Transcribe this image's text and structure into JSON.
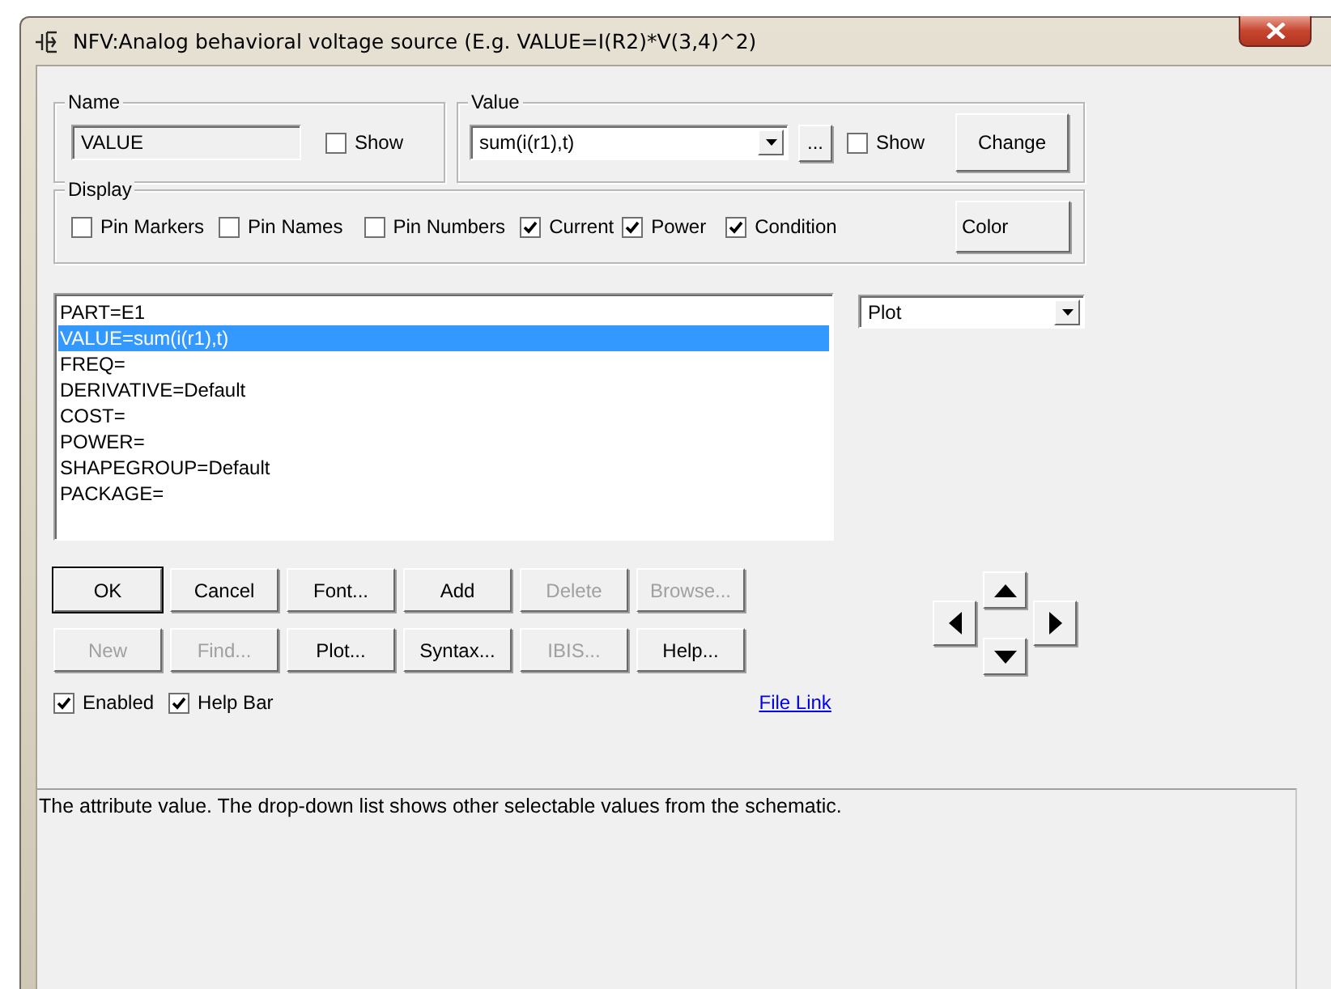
{
  "window": {
    "title": "NFV:Analog behavioral voltage source (E.g. VALUE=I(R2)*V(3,4)^2)"
  },
  "name_group": {
    "label": "Name",
    "value": "VALUE",
    "show": {
      "label": "Show",
      "checked": false
    }
  },
  "value_group": {
    "label": "Value",
    "value": "sum(i(r1),t)",
    "browse": "...",
    "show": {
      "label": "Show",
      "checked": false
    },
    "change": "Change"
  },
  "display": {
    "label": "Display",
    "options": [
      {
        "label": "Pin Markers",
        "checked": false
      },
      {
        "label": "Pin Names",
        "checked": false
      },
      {
        "label": "Pin Numbers",
        "checked": false
      },
      {
        "label": "Current",
        "checked": true
      },
      {
        "label": "Power",
        "checked": true
      },
      {
        "label": "Condition",
        "checked": true
      }
    ],
    "color_button": "Color"
  },
  "attributes": [
    {
      "text": "PART=E1",
      "selected": false
    },
    {
      "text": "VALUE=sum(i(r1),t)",
      "selected": true
    },
    {
      "text": "FREQ=",
      "selected": false
    },
    {
      "text": "DERIVATIVE=Default",
      "selected": false
    },
    {
      "text": "COST=",
      "selected": false
    },
    {
      "text": "POWER=",
      "selected": false
    },
    {
      "text": "SHAPEGROUP=Default",
      "selected": false
    },
    {
      "text": "PACKAGE=",
      "selected": false
    }
  ],
  "plot_combo": {
    "value": "Plot"
  },
  "buttons": [
    [
      {
        "label": "OK",
        "disabled": false
      },
      {
        "label": "Cancel",
        "disabled": false
      },
      {
        "label": "Font...",
        "disabled": false
      },
      {
        "label": "Add",
        "disabled": false
      },
      {
        "label": "Delete",
        "disabled": true
      },
      {
        "label": "Browse...",
        "disabled": true
      }
    ],
    [
      {
        "label": "New",
        "disabled": true
      },
      {
        "label": "Find...",
        "disabled": true
      },
      {
        "label": "Plot...",
        "disabled": false
      },
      {
        "label": "Syntax...",
        "disabled": false
      },
      {
        "label": "IBIS...",
        "disabled": true
      },
      {
        "label": "Help...",
        "disabled": false
      }
    ]
  ],
  "options": [
    {
      "label": "Enabled",
      "checked": true
    },
    {
      "label": "Help Bar",
      "checked": true
    }
  ],
  "file_link": "File Link",
  "help_text": "The attribute value. The drop-down list shows other selectable values from the schematic."
}
